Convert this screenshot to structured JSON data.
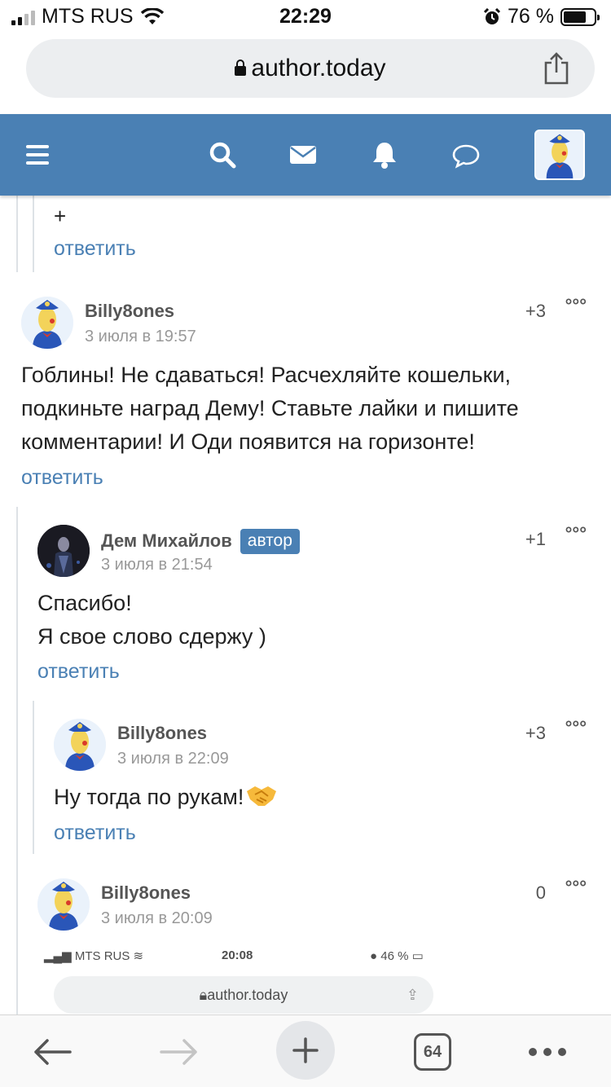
{
  "status_bar": {
    "carrier": "MTS RUS",
    "time": "22:29",
    "battery_percent": "76 %",
    "battery_level": 0.76
  },
  "browser": {
    "url": "author.today",
    "tabs_count": "64"
  },
  "header": {
    "icons": [
      "menu-icon",
      "search-icon",
      "mail-icon",
      "bell-icon",
      "chat-icon"
    ],
    "brand_color": "#4a80b4"
  },
  "thread": {
    "prev_plus": "+",
    "prev_reply": "ответить",
    "comments": [
      {
        "author": "Billy8ones",
        "date": "3 июля в 19:57",
        "score": "+3",
        "lines": [
          "Гоблины! Не сдаваться! Расчехляйте кошельки,",
          "подкиньте наград Дему! Ставьте лайки и пишите",
          "комментарии! И Оди появится на горизонте!"
        ],
        "reply": "ответить"
      },
      {
        "author": "Дем Михайлов",
        "badge": "автор",
        "date": "3 июля в 21:54",
        "score": "+1",
        "lines": [
          "Спасибо!",
          "Я свое слово сдержу )"
        ],
        "reply": "ответить"
      },
      {
        "author": "Billy8ones",
        "date": "3 июля в 22:09",
        "score": "+3",
        "lines": [
          "Ну тогда по рукам!"
        ],
        "reply": "ответить"
      },
      {
        "author": "Billy8ones",
        "date": "3 июля в 20:09",
        "score": "0",
        "embed": {
          "carrier": "MTS RUS",
          "time": "20:08",
          "battery": "46 %",
          "url": "author.today"
        }
      }
    ]
  }
}
